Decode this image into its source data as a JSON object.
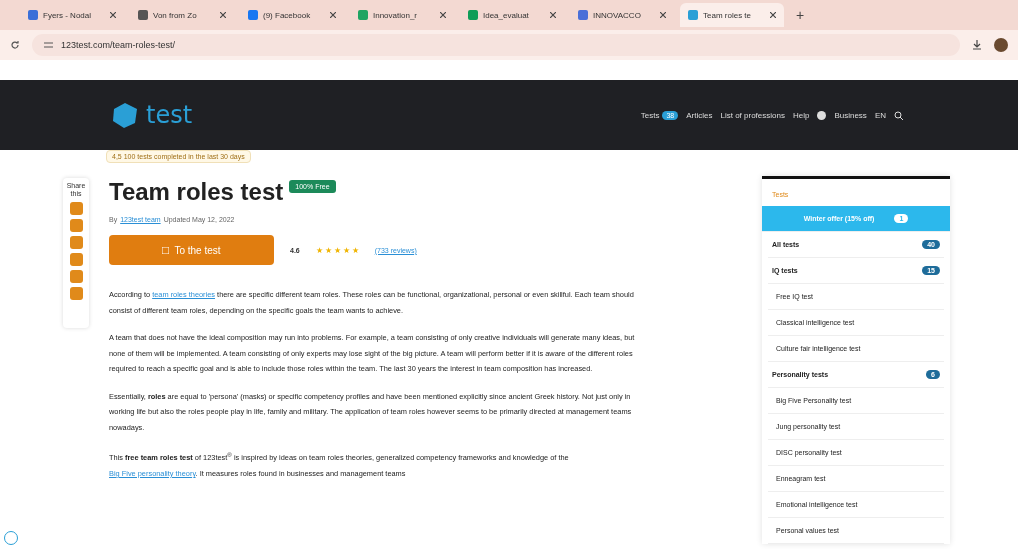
{
  "browser": {
    "tabs": [
      {
        "title": "Fyers - Nodal",
        "selected": false,
        "color": "#3a6fd8"
      },
      {
        "title": "Von from Zo",
        "selected": false,
        "color": "#555555"
      },
      {
        "title": "(9) Facebook",
        "selected": false,
        "color": "#1877f2"
      },
      {
        "title": "Innovation_r",
        "selected": false,
        "color": "#1fa463"
      },
      {
        "title": "Idea_evaluat",
        "selected": false,
        "color": "#0f9d58"
      },
      {
        "title": "INNOVACCO",
        "selected": false,
        "color": "#4a6fd8"
      },
      {
        "title": "Team roles te",
        "selected": true,
        "color": "#2a9fd6"
      }
    ],
    "new_tab": "+",
    "url": "123test.com/team-roles-test/"
  },
  "nav": {
    "items": [
      {
        "label": "Tests",
        "badge": "38"
      },
      {
        "label": "Articles"
      },
      {
        "label": "List of professions"
      },
      {
        "label": "Help"
      },
      {
        "kind": "user"
      },
      {
        "label": "Business"
      },
      {
        "label": "EN"
      },
      {
        "kind": "search"
      }
    ],
    "logo": "test",
    "notice": "4,5 100 tests completed in the last 30 days"
  },
  "share": {
    "label": "Share this"
  },
  "article": {
    "title": "Team roles test",
    "badge": "100% Free",
    "byline_prefix": "By",
    "author": "123test team",
    "updated": "Updated May 12, 2022",
    "cta": "To the test",
    "rating": "4.6",
    "stars": 5,
    "reviews": "(733 reviews)",
    "paragraphs": [
      {
        "before": "According to",
        "link": "team roles theories",
        "after": "there are specific different team roles. These roles can be functional, organizational, personal or even skillful. Each team should consist of different team roles, depending on the specific goals the team wants to achieve."
      },
      {
        "before": "A team that does not have the ideal composition may run into problems. For example, a team consisting of only creative individuals will generate many ideas, but none of them will be implemented. A team consisting of only experts may lose sight of the big picture. A team will perform better if it is aware of the different roles required to reach a specific goal and is able to include those roles within the team. The last 30 years the interest in team composition has increased."
      },
      {
        "before": "Essentially, **roles** are equal to 'persona' (masks) or specific competency profiles and have been mentioned explicitly since ancient Greek history. Not just only in working life but also the roles people play in life, family and military. The application of team roles however seems to be primarily directed at management teams nowadays."
      },
      {
        "before": "This **free team roles test** of 123test$^{®}$ is inspired by ideas on team roles theories, generalized competency frameworks and knowledge of the",
        "link": "Big Five personality theory",
        "after": ". It measures roles found in businesses and management teams"
      }
    ]
  },
  "sidebar": {
    "heading": "Tests",
    "items": [
      {
        "label": "Winter offer (15% off)",
        "kind": "offer",
        "badge": "1",
        "selected": true
      },
      {
        "label": "All tests",
        "kind": "group",
        "badge": "40"
      },
      {
        "label": "IQ tests",
        "kind": "group",
        "badge": "15"
      },
      {
        "label": "Free IQ test",
        "kind": "item"
      },
      {
        "label": "Classical intelligence test",
        "kind": "item"
      },
      {
        "label": "Culture fair intelligence test",
        "kind": "item"
      },
      {
        "label": "Personality tests",
        "kind": "group",
        "badge": "6"
      },
      {
        "label": "Big Five Personality test",
        "kind": "item"
      },
      {
        "label": "Jung personality test",
        "kind": "item"
      },
      {
        "label": "DISC personality test",
        "kind": "item"
      },
      {
        "label": "Enneagram test",
        "kind": "item"
      },
      {
        "label": "Emotional intelligence test",
        "kind": "item"
      },
      {
        "label": "Personal values test",
        "kind": "item"
      }
    ]
  }
}
